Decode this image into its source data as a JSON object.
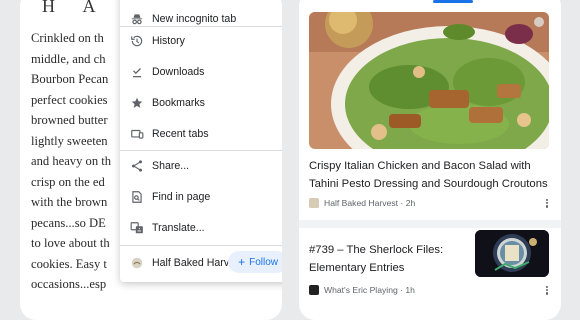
{
  "article": {
    "title": "H A R",
    "lines": [
      "Crinkled on th",
      "middle, and ch",
      "Bourbon Pecan",
      "perfect cookies",
      "browned butter",
      "lightly sweeten",
      "and heavy on th",
      "crisp on the ed",
      "with the brown",
      "pecans...so DE",
      "to love about th",
      "cookies. Easy t",
      "occasions...esp"
    ]
  },
  "menu": {
    "items": [
      {
        "label": "New incognito tab",
        "icon": "incognito-icon"
      },
      {
        "label": "History",
        "icon": "history-icon"
      },
      {
        "label": "Downloads",
        "icon": "download-icon"
      },
      {
        "label": "Bookmarks",
        "icon": "star-icon"
      },
      {
        "label": "Recent tabs",
        "icon": "devices-icon"
      },
      {
        "label": "Share...",
        "icon": "share-icon"
      },
      {
        "label": "Find in page",
        "icon": "find-icon"
      },
      {
        "label": "Translate...",
        "icon": "translate-icon"
      }
    ],
    "follow_site": {
      "name": "Half Baked Harvest",
      "button_label": "Follow",
      "button_icon": "plus-icon"
    }
  },
  "feed": {
    "cards": [
      {
        "title": "Crispy Italian Chicken and Bacon Salad with Tahini Pesto Dressing and Sourdough Croutons",
        "source": "Half Baked Harvest",
        "age": "2h"
      },
      {
        "title": "#739 – The Sherlock Files: Elementary Entries",
        "source": "What's Eric Playing",
        "age": "1h"
      }
    ]
  },
  "colors": {
    "accent": "#1a73e8",
    "follow_bg": "#e8f0fe",
    "text": "#202124",
    "secondary_text": "#5f6368"
  }
}
